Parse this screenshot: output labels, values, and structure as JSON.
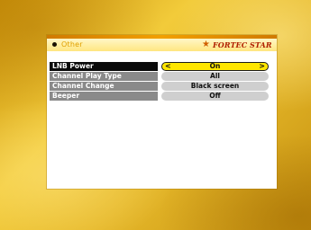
{
  "header": {
    "title": "Other",
    "brand": "FORTEC STAR"
  },
  "settings": [
    {
      "label": "LNB Power",
      "value": "On",
      "selected": true
    },
    {
      "label": "Channel Play Type",
      "value": "All",
      "selected": false
    },
    {
      "label": "Channel Change",
      "value": "Black screen",
      "selected": false
    },
    {
      "label": "Beeper",
      "value": "Off",
      "selected": false
    }
  ],
  "colors": {
    "background": "#e2b416",
    "header_bar": "#f2a000",
    "selected_value": "#ffe600",
    "label_bg": "#8a8a8a",
    "value_bg": "#cfcfcf"
  },
  "icons": {
    "left_arrow": "chevron-left-icon",
    "right_arrow": "chevron-right-icon",
    "brand_star": "star-icon"
  }
}
